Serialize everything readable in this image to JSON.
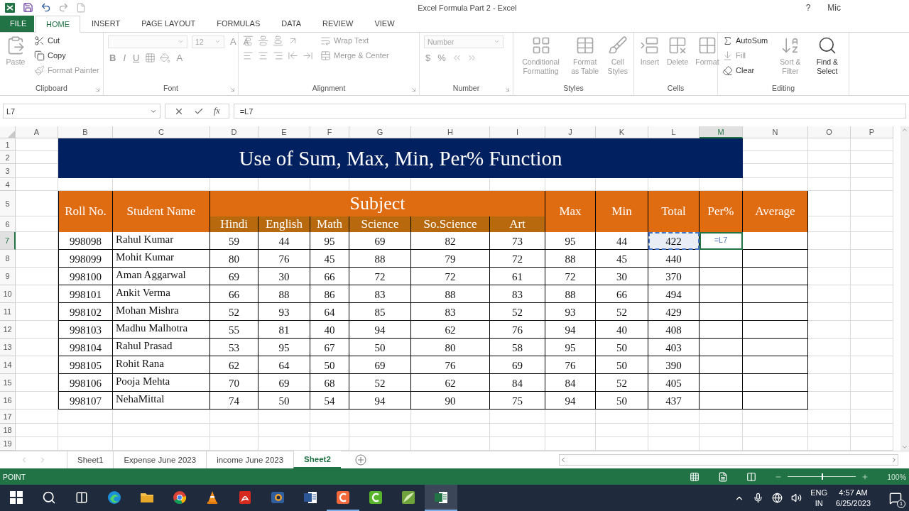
{
  "title_bar": {
    "title": "Excel Formula Part 2 - Excel",
    "help": "?",
    "account": "Mic"
  },
  "ribbon_tabs": [
    {
      "label": "FILE",
      "kind": "file",
      "selected": false
    },
    {
      "label": "HOME",
      "kind": "tab",
      "selected": true
    },
    {
      "label": "INSERT",
      "kind": "tab",
      "selected": false
    },
    {
      "label": "PAGE LAYOUT",
      "kind": "tab",
      "selected": false
    },
    {
      "label": "FORMULAS",
      "kind": "tab",
      "selected": false
    },
    {
      "label": "DATA",
      "kind": "tab",
      "selected": false
    },
    {
      "label": "REVIEW",
      "kind": "tab",
      "selected": false
    },
    {
      "label": "VIEW",
      "kind": "tab",
      "selected": false
    }
  ],
  "ribbon_groups": [
    {
      "name": "Clipboard",
      "launcher": true,
      "sections": [
        [
          [
            {
              "kind": "large",
              "label": "Paste",
              "disabled": true
            }
          ]
        ],
        [
          [
            {
              "kind": "small",
              "label": "Cut",
              "disabled": false
            }
          ],
          [
            {
              "kind": "small",
              "label": "Copy",
              "disabled": false
            }
          ],
          [
            {
              "kind": "small",
              "label": "Format Painter",
              "disabled": true
            }
          ]
        ]
      ]
    },
    {
      "name": "Font",
      "launcher": true,
      "sections": [
        [
          [
            {
              "kind": "field",
              "disabled": true
            },
            {
              "kind": "field",
              "value": "12",
              "disabled": true
            },
            {
              "kind": "glyph",
              "label": "A",
              "disabled": true
            },
            {
              "kind": "glyph",
              "label": "A",
              "disabled": true
            }
          ],
          [
            {
              "kind": "glyph",
              "label": "B",
              "disabled": true
            },
            {
              "kind": "glyph",
              "label": "I",
              "disabled": true
            },
            {
              "kind": "glyph",
              "label": "U",
              "disabled": true
            },
            {
              "kind": "icon",
              "disabled": true
            },
            {
              "kind": "icon",
              "disabled": true
            },
            {
              "kind": "glyph",
              "label": "A",
              "disabled": true
            }
          ]
        ]
      ]
    },
    {
      "name": "Alignment",
      "launcher": true,
      "sections": [
        [
          [
            {
              "kind": "icon",
              "disabled": true
            },
            {
              "kind": "icon",
              "disabled": true
            },
            {
              "kind": "icon",
              "disabled": true
            },
            {
              "kind": "icon",
              "disabled": true
            }
          ],
          [
            {
              "kind": "icon",
              "disabled": true
            },
            {
              "kind": "icon",
              "disabled": true
            },
            {
              "kind": "icon",
              "disabled": true
            },
            {
              "kind": "icon",
              "disabled": true
            },
            {
              "kind": "icon",
              "disabled": true
            }
          ]
        ],
        [
          [
            {
              "kind": "small",
              "label": "Wrap Text",
              "disabled": true
            }
          ],
          [
            {
              "kind": "small",
              "label": "Merge & Center",
              "disabled": true
            }
          ]
        ]
      ]
    },
    {
      "name": "Number",
      "launcher": true,
      "sections": [
        [
          [
            {
              "kind": "field",
              "value": "Number",
              "disabled": true
            }
          ],
          [
            {
              "kind": "glyph",
              "label": "$",
              "disabled": true
            },
            {
              "kind": "glyph",
              "label": "%",
              "disabled": true
            },
            {
              "kind": "icon",
              "disabled": true
            },
            {
              "kind": "icon",
              "disabled": true
            }
          ]
        ]
      ]
    },
    {
      "name": "Styles",
      "launcher": false,
      "sections": [
        [
          [
            {
              "kind": "large",
              "label": "Conditional Formatting",
              "disabled": true
            },
            {
              "kind": "large",
              "label": "Format as Table",
              "disabled": true
            },
            {
              "kind": "large",
              "label": "Cell Styles",
              "disabled": true
            }
          ]
        ]
      ]
    },
    {
      "name": "Cells",
      "launcher": false,
      "sections": [
        [
          [
            {
              "kind": "large",
              "label": "Insert",
              "disabled": true
            },
            {
              "kind": "large",
              "label": "Delete",
              "disabled": true
            },
            {
              "kind": "large",
              "label": "Format",
              "disabled": true
            }
          ]
        ]
      ]
    },
    {
      "name": "Editing",
      "launcher": false,
      "sections": [
        [
          [
            {
              "kind": "small",
              "label": "AutoSum",
              "disabled": false
            }
          ],
          [
            {
              "kind": "small",
              "label": "Fill",
              "disabled": true
            }
          ],
          [
            {
              "kind": "small",
              "label": "Clear",
              "disabled": false
            }
          ]
        ],
        [
          [
            {
              "kind": "large",
              "label": "Sort & Filter",
              "disabled": true
            },
            {
              "kind": "large",
              "label": "Find & Select",
              "disabled": false
            }
          ]
        ]
      ]
    }
  ],
  "formula_bar": {
    "name_box": "L7",
    "function_label": "fx",
    "formula": "=L7"
  },
  "columns": [
    {
      "label": "A",
      "selected": false
    },
    {
      "label": "B",
      "selected": false
    },
    {
      "label": "C",
      "selected": false
    },
    {
      "label": "D",
      "selected": false
    },
    {
      "label": "E",
      "selected": false
    },
    {
      "label": "F",
      "selected": false
    },
    {
      "label": "G",
      "selected": false
    },
    {
      "label": "H",
      "selected": false
    },
    {
      "label": "I",
      "selected": false
    },
    {
      "label": "J",
      "selected": false
    },
    {
      "label": "K",
      "selected": false
    },
    {
      "label": "L",
      "selected": false
    },
    {
      "label": "M",
      "selected": true
    },
    {
      "label": "N",
      "selected": false
    },
    {
      "label": "O",
      "selected": false
    },
    {
      "label": "P",
      "selected": false
    }
  ],
  "rows": [
    {
      "label": "1",
      "selected": false
    },
    {
      "label": "2",
      "selected": false
    },
    {
      "label": "3",
      "selected": false
    },
    {
      "label": "4",
      "selected": false
    },
    {
      "label": "5",
      "selected": false
    },
    {
      "label": "6",
      "selected": false
    },
    {
      "label": "7",
      "selected": true
    },
    {
      "label": "8",
      "selected": false
    },
    {
      "label": "9",
      "selected": false
    },
    {
      "label": "10",
      "selected": false
    },
    {
      "label": "11",
      "selected": false
    },
    {
      "label": "12",
      "selected": false
    },
    {
      "label": "13",
      "selected": false
    },
    {
      "label": "14",
      "selected": false
    },
    {
      "label": "15",
      "selected": false
    },
    {
      "label": "16",
      "selected": false
    },
    {
      "label": "17",
      "selected": false
    },
    {
      "label": "18",
      "selected": false
    },
    {
      "label": "19",
      "selected": false
    }
  ],
  "table": {
    "title": "Use of Sum, Max, Min, Per% Function",
    "headers": {
      "roll": "Roll No.",
      "name": "Student Name",
      "subject": "Subject",
      "subjects": [
        "Hindi",
        "English",
        "Math",
        "Science",
        "So.Science",
        "Art"
      ],
      "max": "Max",
      "min": "Min",
      "total": "Total",
      "per": "Per%",
      "average": "Average"
    },
    "students": [
      {
        "roll": "998098",
        "name": "Rahul Kumar",
        "marks": [
          "59",
          "44",
          "95",
          "69",
          "82",
          "73"
        ],
        "max": "95",
        "min": "44",
        "total": "422",
        "total_referenced": true,
        "per": "=L7",
        "editing": true
      },
      {
        "roll": "998099",
        "name": "Mohit Kumar",
        "marks": [
          "80",
          "76",
          "45",
          "88",
          "79",
          "72"
        ],
        "max": "88",
        "min": "45",
        "total": "440",
        "total_referenced": false,
        "editing": false
      },
      {
        "roll": "998100",
        "name": "Aman Aggarwal",
        "marks": [
          "69",
          "30",
          "66",
          "72",
          "72",
          "61"
        ],
        "max": "72",
        "min": "30",
        "total": "370",
        "total_referenced": false,
        "editing": false
      },
      {
        "roll": "998101",
        "name": "Ankit Verma",
        "marks": [
          "66",
          "88",
          "86",
          "83",
          "88",
          "83"
        ],
        "max": "88",
        "min": "66",
        "total": "494",
        "total_referenced": false,
        "editing": false
      },
      {
        "roll": "998102",
        "name": "Mohan Mishra",
        "marks": [
          "52",
          "93",
          "64",
          "85",
          "83",
          "52"
        ],
        "max": "93",
        "min": "52",
        "total": "429",
        "total_referenced": false,
        "editing": false
      },
      {
        "roll": "998103",
        "name": "Madhu Malhotra",
        "marks": [
          "55",
          "81",
          "40",
          "94",
          "62",
          "76"
        ],
        "max": "94",
        "min": "40",
        "total": "408",
        "total_referenced": false,
        "editing": false
      },
      {
        "roll": "998104",
        "name": "Rahul Prasad",
        "marks": [
          "53",
          "95",
          "67",
          "50",
          "80",
          "58"
        ],
        "max": "95",
        "min": "50",
        "total": "403",
        "total_referenced": false,
        "editing": false
      },
      {
        "roll": "998105",
        "name": "Rohit Rana",
        "marks": [
          "62",
          "64",
          "50",
          "69",
          "76",
          "69"
        ],
        "max": "76",
        "min": "50",
        "total": "390",
        "total_referenced": false,
        "editing": false
      },
      {
        "roll": "998106",
        "name": "Pooja Mehta",
        "marks": [
          "70",
          "69",
          "68",
          "52",
          "62",
          "84"
        ],
        "max": "84",
        "min": "52",
        "total": "405",
        "total_referenced": false,
        "editing": false
      },
      {
        "roll": "998107",
        "name": "NehaMittal",
        "marks": [
          "74",
          "50",
          "54",
          "94",
          "90",
          "75"
        ],
        "max": "94",
        "min": "50",
        "total": "437",
        "total_referenced": false,
        "editing": false
      }
    ]
  },
  "sheet_tabs": [
    {
      "label": "Sheet1",
      "selected": false
    },
    {
      "label": "Expense June 2023",
      "selected": false
    },
    {
      "label": "income June 2023",
      "selected": false
    },
    {
      "label": "Sheet2",
      "selected": true
    }
  ],
  "status_bar": {
    "mode": "POINT",
    "zoom": "100%",
    "level": 0.5
  },
  "taskbar": {
    "apps": [
      {
        "kind": "edge",
        "selected": false,
        "running": false
      },
      {
        "kind": "folder",
        "selected": false,
        "running": false
      },
      {
        "kind": "chrome",
        "selected": false,
        "running": false
      },
      {
        "kind": "cone",
        "selected": false,
        "running": false
      },
      {
        "kind": "pdf",
        "selected": false,
        "running": false
      },
      {
        "kind": "media",
        "selected": false,
        "running": false
      },
      {
        "kind": "word",
        "selected": false,
        "running": false
      },
      {
        "kind": "recorder",
        "selected": false,
        "running": true
      },
      {
        "kind": "editor",
        "selected": false,
        "running": false
      },
      {
        "kind": "leaf",
        "selected": false,
        "running": false
      },
      {
        "kind": "sheet",
        "selected": true,
        "running": true
      }
    ],
    "tray": {
      "language": "ENG",
      "region": "IN",
      "time": "4:57 AM",
      "date": "6/25/2023",
      "notifications": "1"
    }
  }
}
